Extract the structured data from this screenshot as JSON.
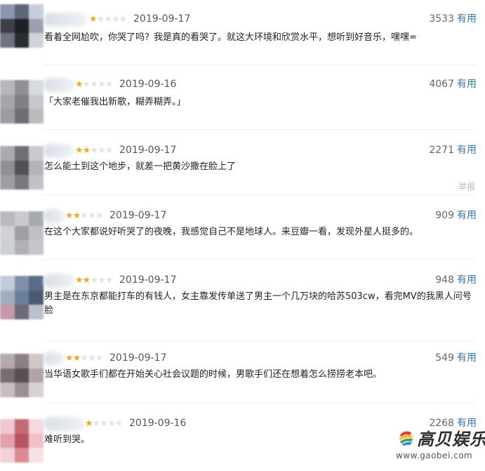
{
  "colors": {
    "star_on": "#f5a623",
    "star_off": "#e3e3e3",
    "useful_link": "#3377aa"
  },
  "useful_label": "有用",
  "report_label": "举报",
  "comments": [
    {
      "stars": 1,
      "date": "2019-09-17",
      "votes": "3533",
      "text": "看着全网尬吹，你哭了吗？我是真的看哭了。就这大环境和欣赏水平，想听到好音乐，嘿嘿="
    },
    {
      "stars": 1,
      "date": "2019-09-16",
      "votes": "4067",
      "text": "「大家老催我出新歌，糊弄糊弄。」"
    },
    {
      "stars": 2,
      "date": "2019-09-17",
      "votes": "2271",
      "text": "怎么能土到这个地步，就差一把黄沙撒在脸上了"
    },
    {
      "stars": 2,
      "date": "2019-09-17",
      "votes": "909",
      "text": "在这个大家都说好听哭了的夜晚，我感觉自己不是地球人。来豆瓣一看，发现外星人挺多的。"
    },
    {
      "stars": 2,
      "date": "2019-09-17",
      "votes": "948",
      "text": "男主是在东京都能打车的有钱人，女主靠发传单送了男主一个几万块的哈苏503cw，看完MV的我黑人问号脸"
    },
    {
      "stars": 2,
      "date": "2019-09-17",
      "votes": "549",
      "text": "当华语女歌手们都在开始关心社会议题的时候，男歌手们还在想着怎么捞捞老本吧。"
    },
    {
      "stars": 1,
      "date": "2019-09-16",
      "votes": "2268",
      "text": "难听到哭。"
    }
  ],
  "watermark": {
    "title": "高贝娱乐",
    "url": "www.gaobei.com"
  }
}
